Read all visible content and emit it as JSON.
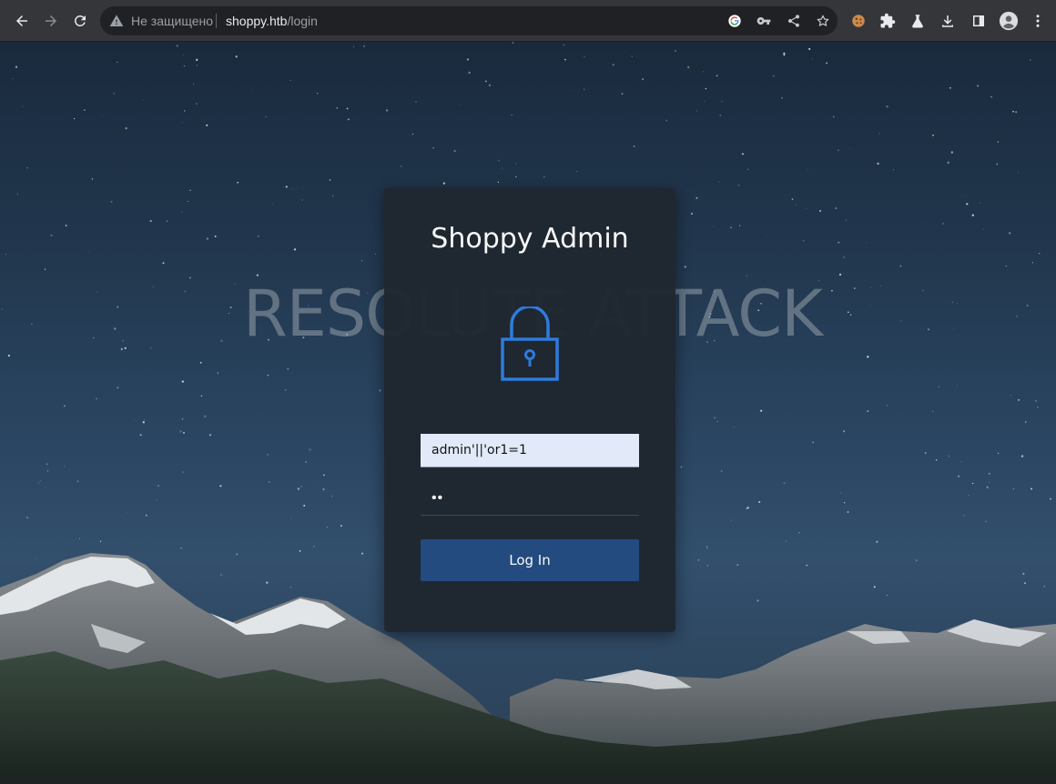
{
  "browser": {
    "security_text": "Не защищено",
    "url_host": "shoppy.htb",
    "url_path": "/login"
  },
  "page": {
    "watermark": "RESOLUTE ATTACK",
    "title": "Shoppy Admin",
    "username_value": "admin'||'or1=1",
    "password_mask": "••",
    "login_label": "Log In"
  },
  "icons": {
    "back": "arrow-left-icon",
    "forward": "arrow-right-icon",
    "reload": "reload-icon",
    "security": "warning-triangle-icon",
    "google": "google-icon",
    "key": "key-icon",
    "share": "share-icon",
    "bookmark": "star-icon",
    "cookie": "cookie-icon",
    "extensions": "puzzle-icon",
    "labs": "flask-icon",
    "download": "download-icon",
    "sidepanel": "side-panel-icon",
    "profile": "profile-icon",
    "menu": "kebab-menu-icon",
    "lock": "padlock-icon"
  },
  "colors": {
    "card_bg": "#1f2730",
    "button_bg": "#244b80",
    "lock_stroke": "#2f7de0",
    "input_autofill_bg": "#e8f0fe"
  }
}
